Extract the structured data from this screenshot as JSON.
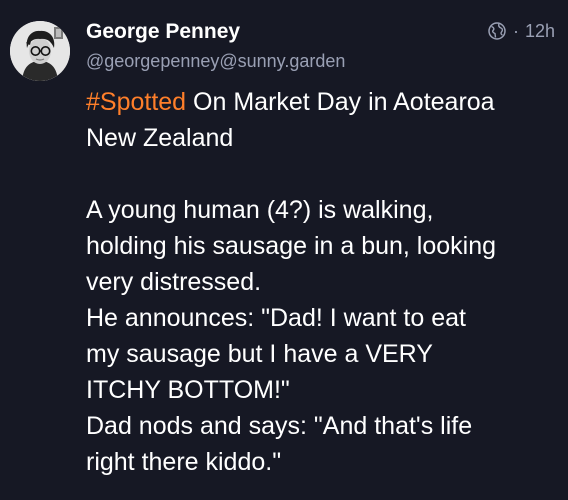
{
  "post": {
    "author": {
      "display_name": "George Penney",
      "handle": "@georgepenney@sunny.garden"
    },
    "visibility_icon": "globe-icon",
    "separator": "·",
    "timestamp": "12h",
    "hashtag": "#Spotted",
    "colors": {
      "background": "#161824",
      "hashtag": "#ff7f2a",
      "secondary_text": "#9aa0b4"
    },
    "lines": [
      " On Market Day in Aotearoa",
      "New Zealand",
      "A young human (4?) is walking,",
      "holding his sausage in a bun, looking",
      "very distressed.",
      "He announces: \"Dad! I want to eat",
      "my sausage but I have a VERY",
      "ITCHY BOTTOM!\"",
      "Dad nods and says: \"And that's life",
      "right there kiddo.\""
    ]
  }
}
